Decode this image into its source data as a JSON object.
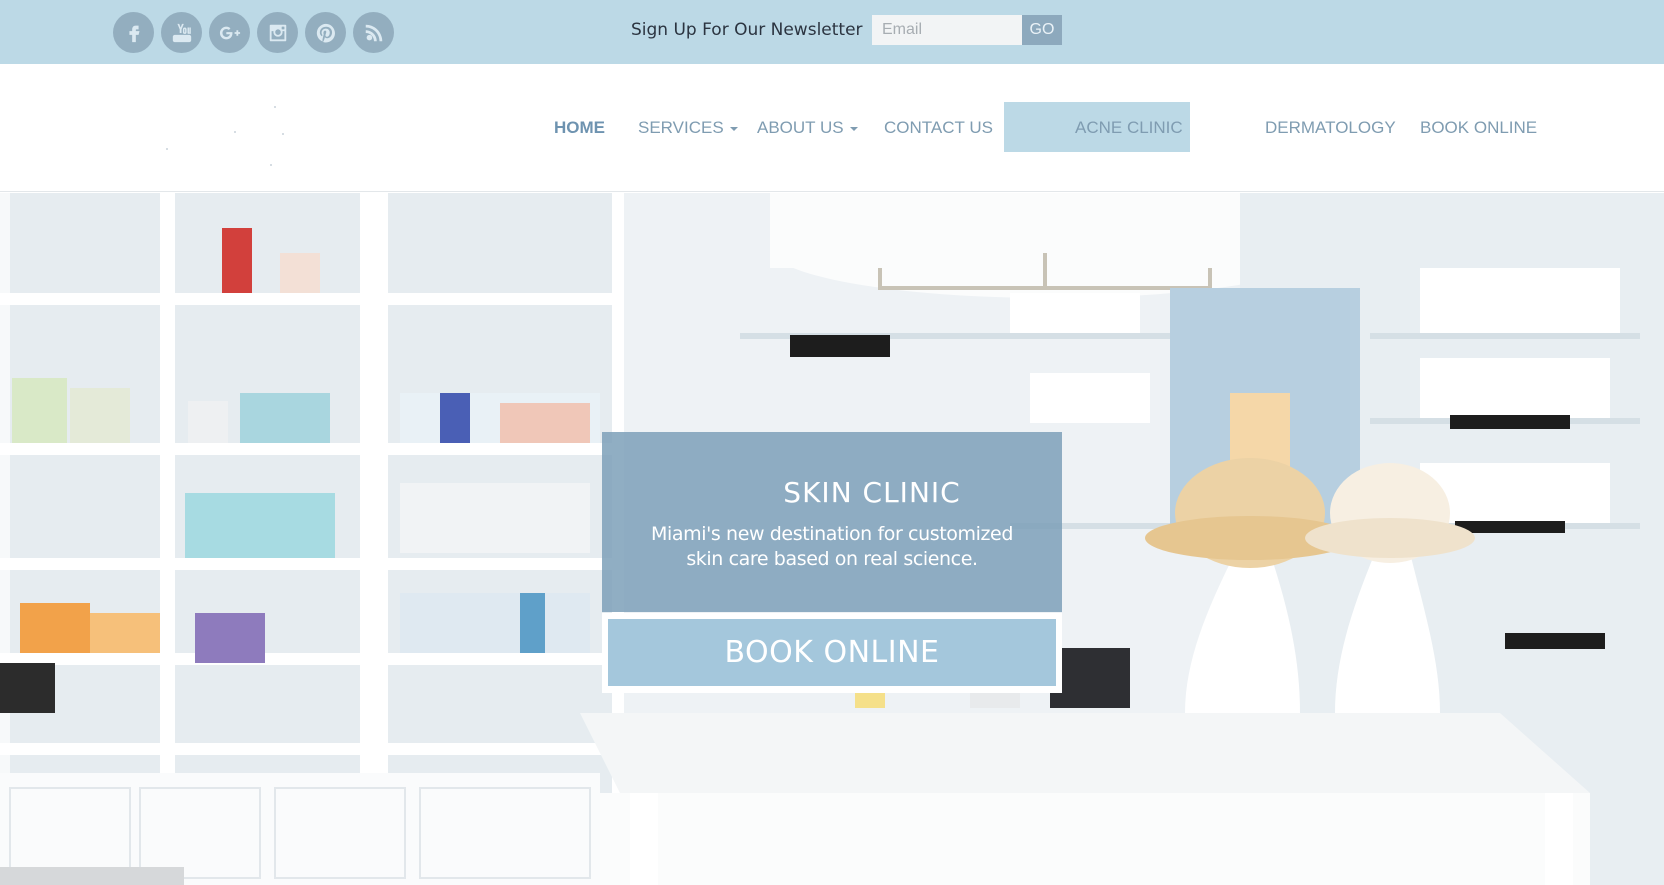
{
  "topbar": {
    "social": [
      {
        "icon": "facebook-icon"
      },
      {
        "icon": "youtube-icon"
      },
      {
        "icon": "google-plus-icon"
      },
      {
        "icon": "instagram-icon"
      },
      {
        "icon": "pinterest-icon"
      },
      {
        "icon": "rss-icon"
      }
    ],
    "newsletter_label": "Sign Up For Our Newsletter",
    "email_placeholder": "Email",
    "go_label": "GO"
  },
  "nav": {
    "home": "HOME",
    "services": "SERVICES",
    "about": "ABOUT US",
    "contact": "CONTACT US",
    "acne": "ACNE CLINIC",
    "dermatology": "DERMATOLOGY",
    "book": "BOOK ONLINE"
  },
  "hero": {
    "title": "SKIN CLINIC",
    "subtitle_line1": "Miami's new destination for customized",
    "subtitle_line2": "skin care based on real science.",
    "cta": "BOOK ONLINE"
  },
  "colors": {
    "topbar_bg": "#bcd9e6",
    "nav_text": "#7f9cb1",
    "promo_bg": "#7da0b9",
    "cta_bg": "#a4c7dc"
  }
}
